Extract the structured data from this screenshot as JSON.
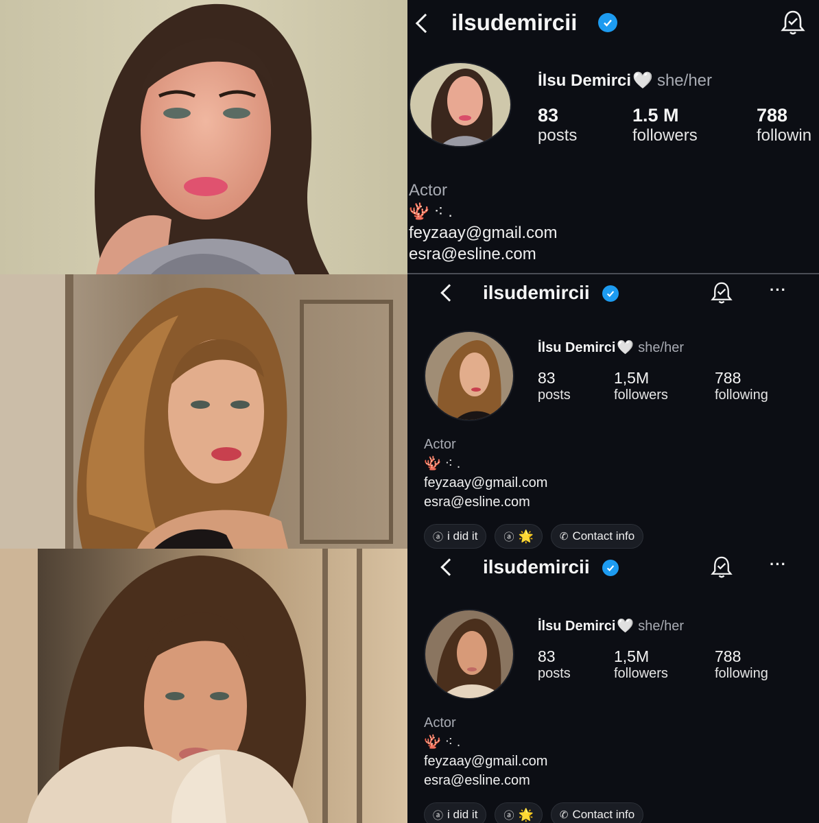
{
  "panels": [
    {
      "username": "ilsudemircii",
      "display_name": "İlsu Demirci",
      "heart": "🤍",
      "pronouns": "she/her",
      "stats": [
        {
          "value": "83",
          "label": "posts"
        },
        {
          "value": "1.5 M",
          "label": "followers"
        },
        {
          "value": "788",
          "label": "followin"
        }
      ],
      "bio": {
        "category": "Actor",
        "emoji_line": "🪸 ⁖ .",
        "lines": [
          "feyzaay@gmail.com",
          "esra@esline.com"
        ]
      }
    },
    {
      "username": "ilsudemircii",
      "display_name": "İlsu Demirci",
      "heart": "🤍",
      "pronouns": "she/her",
      "more": "···",
      "stats": [
        {
          "value": "83",
          "label": "posts"
        },
        {
          "value": "1,5M",
          "label": "followers"
        },
        {
          "value": "788",
          "label": "following"
        }
      ],
      "bio": {
        "category": "Actor",
        "emoji_line": "🪸 ⁖ .",
        "lines": [
          "feyzaay@gmail.com",
          "esra@esline.com"
        ]
      },
      "chips": [
        {
          "icon": "threads-icon",
          "label": "i did it"
        },
        {
          "icon": "threads-icon",
          "label": "🌟"
        },
        {
          "icon": "phone-icon",
          "label": "Contact info"
        }
      ]
    },
    {
      "username": "ilsudemircii",
      "display_name": "İlsu Demirci",
      "heart": "🤍",
      "pronouns": "she/her",
      "more": "···",
      "stats": [
        {
          "value": "83",
          "label": "posts"
        },
        {
          "value": "1,5M",
          "label": "followers"
        },
        {
          "value": "788",
          "label": "following"
        }
      ],
      "bio": {
        "category": "Actor",
        "emoji_line": "🪸 ⁖ .",
        "lines": [
          "feyzaay@gmail.com",
          "esra@esline.com"
        ]
      },
      "chips": [
        {
          "icon": "threads-icon",
          "label": "i did it"
        },
        {
          "icon": "threads-icon",
          "label": "🌟"
        },
        {
          "icon": "phone-icon",
          "label": "Contact info"
        }
      ]
    }
  ],
  "colors": {
    "background": "#0c0e14",
    "verified": "#1d9bf0",
    "muted_text": "#a8abb3"
  }
}
